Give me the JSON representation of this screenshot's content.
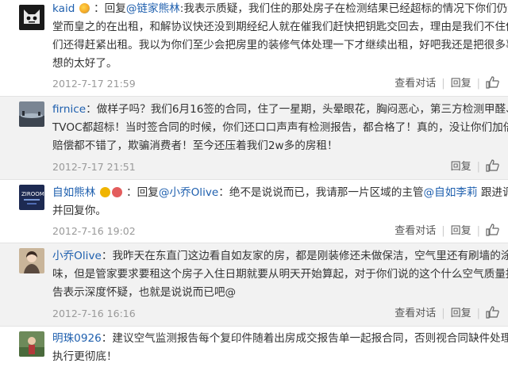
{
  "comments": [
    {
      "username": "kaid",
      "reply_prefix": "：回复",
      "mention": "@链家熊林",
      "lines": [
        ":我表示质疑，我们住的那处房子在检测结果已经超标的情况下你们仍然",
        "堂而皇之的在出租，和解协议快还没到期经纪人就在催我们赶快把钥匙交回去，理由是我们不住他",
        "们还得赶紧出租。我以为你们至少会把房里的装修气体处理一下才继续出租，好吧我还是把很多事",
        "想的太好了。"
      ],
      "time": "2012-7-17 21:59",
      "view_label": "查看对话",
      "reply_label": "回复"
    },
    {
      "username": "firnice",
      "lines_rest": [
        "：做样子吗？我们6月16签的合同，住了一星期，头晕眼花，胸闷恶心，第三方检测甲醛、",
        "TVOC都超标！当时签合同的时候，你们还口口声声有检测报告，都合格了！真的，没让你们加倍",
        "赔偿都不错了，欺骗消费者！至今还压着我们2w多的房租！"
      ],
      "time": "2012-7-17 21:51",
      "reply_label": "回复"
    },
    {
      "username": "自如熊林",
      "reply_prefix": "：回复",
      "mention": "@小乔Olive",
      "mid_text": "：绝不是说说而已，我请那一片区域的主管",
      "mention2": "@自如李莉",
      "tail_text": " 跟进调查",
      "line2": "并回复你。",
      "time": "2012-7-16 19:02",
      "view_label": "查看对话",
      "reply_label": "回复"
    },
    {
      "username": "小乔Olive",
      "lines_rest": [
        "：我昨天在东直门这边看自如友家的房，都是刚装修还未做保洁，空气里还有刷墙的涂料",
        "味，但是管家要求要租这个房子入住日期就要从明天开始算起，对于你们说的这个什么空气质量报",
        "告表示深度怀疑，也就是说说而已吧@"
      ],
      "time": "2012-7-16 16:16",
      "view_label": "查看对话",
      "reply_label": "回复"
    },
    {
      "username": "明珠0926",
      "lines_rest": [
        "：建议空气监测报告每个复印件随着出房成交报告单一起报合同，否则视合同缺件处理！",
        "执行更彻底！"
      ]
    }
  ],
  "colors": {
    "link": "#1e5fae",
    "meta": "#999999",
    "alt_bg": "#f2f2f2"
  },
  "icons": [
    "kaid-avatar",
    "firnice-avatar",
    "ziroo-avatar",
    "xiaoqiao-avatar",
    "mingzhu-avatar",
    "thumb-up-icon",
    "verified-badge-icon"
  ]
}
